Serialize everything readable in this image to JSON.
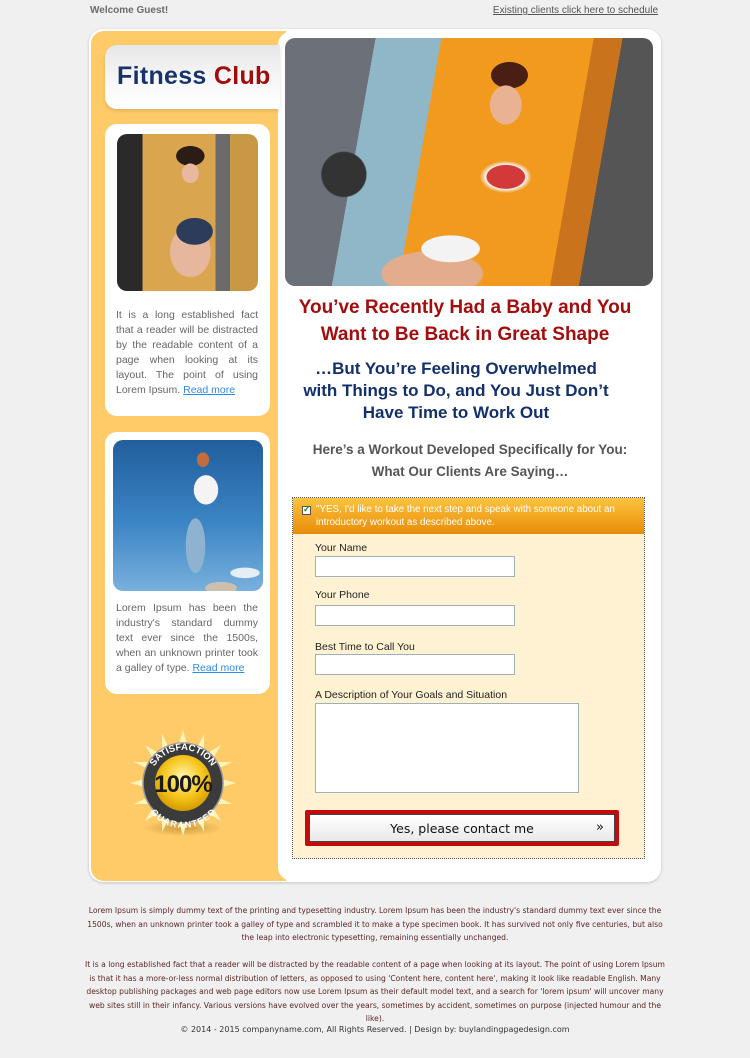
{
  "topbar": {
    "welcome": "Welcome Guest!",
    "existing_link": "Existing clients click here to schedule"
  },
  "logo": {
    "part1": "Fitness",
    "part2": "Club"
  },
  "colors": {
    "brand_navy": "#17336b",
    "brand_red": "#a10c0c",
    "sidebar_bg": "#fecb68",
    "form_bg": "#fef2d2",
    "link_blue": "#2d8ce6"
  },
  "sidebar": {
    "cards": [
      {
        "image": "woman-lifting-dumbbells-photo",
        "text": "It is a long established fact that a reader will be distracted by the readable content of a page when looking at its layout. The point of using Lorem Ipsum.",
        "link": "Read more"
      },
      {
        "image": "woman-balancing-sky-photo",
        "text": "Lorem Ipsum has been the industry's standard dummy text ever since the 1500s, when an unknown printer took a galley of type.",
        "link": "Read more"
      }
    ],
    "badge": {
      "top": "SATISFACTION",
      "center": "100%",
      "bottom": "GUARANTEED"
    }
  },
  "main": {
    "hero_image": "woman-chest-press-machine-photo",
    "headline": "You’ve Recently Had a Baby and You Want to Be Back in Great Shape",
    "subheadline": "…But You’re Feeling Overwhelmed with Things to Do, and You Just Don’t Have Time to Work Out",
    "tagline_1": "Here’s a Workout Developed Specifically for You:",
    "tagline_2": "What Our Clients Are Saying…"
  },
  "form": {
    "consent_checked": true,
    "consent_text": "\"YES, I'd like to take the next step and speak with someone about an introductory workout as described above.",
    "fields": {
      "name_label": "Your Name",
      "name_value": "",
      "phone_label": "Your Phone",
      "phone_value": "",
      "time_label": "Best Time to Call You",
      "time_value": "",
      "description_label": "A Description of Your Goals and Situation",
      "description_value": ""
    },
    "submit_label": "Yes, please contact me",
    "submit_arrow": "»"
  },
  "footer": {
    "paragraph_1": "Lorem Ipsum is simply dummy text of the printing and typesetting industry. Lorem Ipsum has been the industry's standard dummy text ever since the 1500s, when an unknown printer took a galley of type and scrambled it to make a type specimen book. It has survived not only five centuries, but also the leap into electronic typesetting, remaining essentially unchanged.",
    "paragraph_2": "It is a long established fact that a reader will be distracted by the readable content of a page when looking at its layout. The point of using Lorem Ipsum is that it has a more-or-less normal distribution of letters, as opposed to using 'Content here, content here', making it look like readable English. Many desktop publishing packages and web page editors now use Lorem Ipsum as their default model text, and a search for 'lorem ipsum' will uncover many web sites still in their infancy. Various versions have evolved over the years, sometimes by accident, sometimes on purpose (injected humour and the like).",
    "copyright": "© 2014 - 2015  companyname.com, All Rights Reserved. | Design by: buylandingpagedesign.com"
  }
}
